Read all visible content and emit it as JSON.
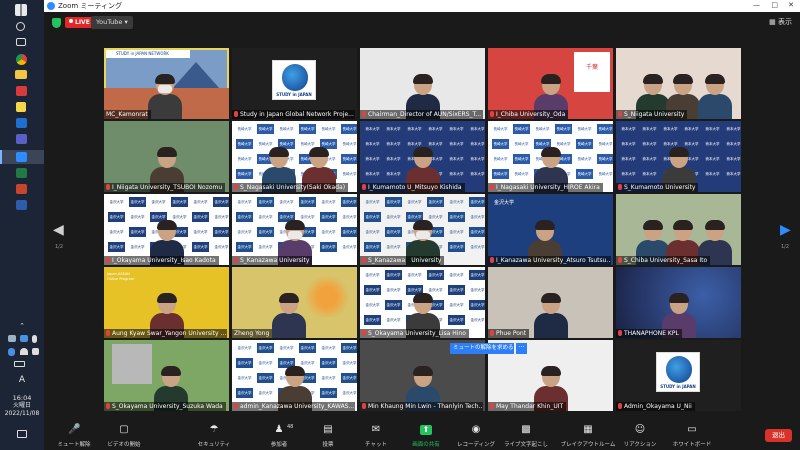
{
  "window": {
    "title": "Zoom ミーティング",
    "view_label": "表示",
    "live_label": "LIVE",
    "stream_target": "YouTube"
  },
  "taskbar": {
    "time": "16:04",
    "day": "火曜日",
    "date": "2022/11/08",
    "ime": "A"
  },
  "pagination": {
    "left": "1/2",
    "right": "1/2"
  },
  "participants": [
    {
      "name": "MC_Kamonrat",
      "muted": false,
      "bg": "#7a9cc7"
    },
    {
      "name": "Study in Japan Global Network Proje...",
      "muted": true,
      "bg": "#1f1f1f"
    },
    {
      "name": "Chairman_Director of AUN/SixERS_T...",
      "muted": true,
      "bg": "#e8e8e8"
    },
    {
      "name": "I_Chiba University_Oda",
      "muted": true,
      "bg": "#d6453f"
    },
    {
      "name": "S_Niigata University",
      "muted": true,
      "bg": "#e6dad0"
    },
    {
      "name": "I_Niigata University_TSUBOI Nozomu",
      "muted": true,
      "bg": "#6f8c6b"
    },
    {
      "name": "S_Nagasaki University(Saki Okada)",
      "muted": true,
      "bg": "#ffffff"
    },
    {
      "name": "I_Kumamoto U_Mitsuyo Kishida",
      "muted": true,
      "bg": "#233b78"
    },
    {
      "name": "I_Nagasaki University_HIROE Akira",
      "muted": true,
      "bg": "#ffffff"
    },
    {
      "name": "S_Kumamoto University",
      "muted": true,
      "bg": "#233b78"
    },
    {
      "name": "I_Okayama University_Isao Kadota",
      "muted": true,
      "bg": "#ffffff"
    },
    {
      "name": "S_Kanazawa University",
      "muted": true,
      "bg": "#ffffff"
    },
    {
      "name": "S_Kanazawa　University",
      "muted": true,
      "bg": "#f2f2f2"
    },
    {
      "name": "I_Kanazawa University_Atsuro Tsutsu...",
      "muted": true,
      "bg": "#1e3f7d"
    },
    {
      "name": "S_Chiba University_Sasa Ito",
      "muted": true,
      "bg": "#a8b896"
    },
    {
      "name": "Aung Kyaw Swar_Yangon University ...",
      "muted": true,
      "bg": "#e6c227"
    },
    {
      "name": "Zheng Yong",
      "muted": false,
      "bg": "#d8c46a"
    },
    {
      "name": "S_Okayama University_Lisa Hino",
      "muted": true,
      "bg": "#ffffff"
    },
    {
      "name": "Phue Pont",
      "muted": true,
      "bg": "#c9c2b9"
    },
    {
      "name": "THANAPHONE KPL",
      "muted": true,
      "bg": "#2e3f7a"
    },
    {
      "name": "S_Okayama University_Suzuka Wada",
      "muted": true,
      "bg": "#7ea664"
    },
    {
      "name": "admin_Kanazawa University_KAWAS...",
      "muted": true,
      "bg": "#ffffff"
    },
    {
      "name": "Min Khaung Min Lwin - Thanlyin Tech...",
      "muted": true,
      "bg": "#4b4b4b"
    },
    {
      "name": "May Thandar Khin_UIT",
      "muted": true,
      "bg": "#efefef"
    },
    {
      "name": "Admin_Okayama U_Nii",
      "muted": true,
      "bg": "#1f1f1f"
    }
  ],
  "logos": {
    "study_in_japan": "STUDY in JAPAN",
    "nagasaki": "長崎大学",
    "kumamoto": "熊本大学",
    "kanazawa": "金沢大学",
    "chiba": "千葉",
    "chiba_en": "CHIBA UNIVERSITY",
    "mc_banner": "STUDY in JAPAN NETWORK",
    "yangon_banner": "Japan-ASEAN Online Program",
    "unmute_popup": "ミュートの解除を求める"
  },
  "toolbar": {
    "items": [
      {
        "label": "ミュート解除",
        "icon": "mic-off"
      },
      {
        "label": "ビデオの開始",
        "icon": "video-off"
      },
      {
        "label": "セキュリティ",
        "icon": "shield"
      },
      {
        "label": "参加者",
        "icon": "people",
        "count": "48"
      },
      {
        "label": "投票",
        "icon": "poll"
      },
      {
        "label": "チャット",
        "icon": "chat"
      },
      {
        "label": "画面の共有",
        "icon": "share"
      },
      {
        "label": "レコーディング",
        "icon": "record"
      },
      {
        "label": "ライブ文字起こし",
        "icon": "cc"
      },
      {
        "label": "ブレイクアウトルーム",
        "icon": "breakout"
      },
      {
        "label": "リアクション",
        "icon": "smile"
      },
      {
        "label": "ホワイトボード",
        "icon": "whiteboard"
      }
    ],
    "leave_label": "退出"
  },
  "colors": {
    "share_green": "#21c45d",
    "leave_red": "#d8322b",
    "live_red": "#e02828",
    "active_speaker": "#e8d65a",
    "popup_blue": "#2d7ff9"
  }
}
